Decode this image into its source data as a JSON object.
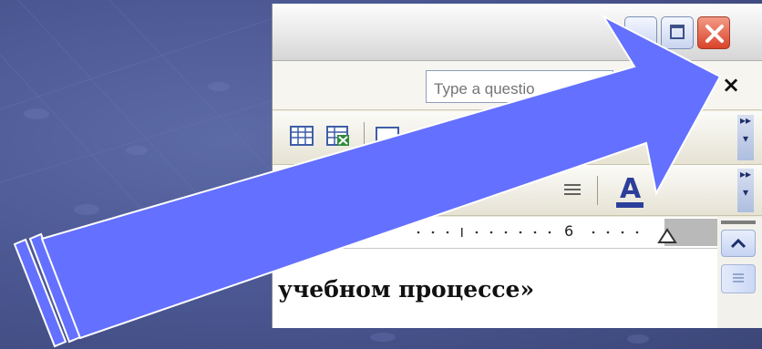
{
  "window": {
    "help_placeholder": "Type a questio",
    "help_close_glyph": "×"
  },
  "ruler": {
    "mark_label": "6"
  },
  "document": {
    "visible_text": "учебном процессе»"
  },
  "colors": {
    "slide_background": "#4a5690",
    "arrow_fill": "#6470ff",
    "close_button": "#d9432a"
  }
}
